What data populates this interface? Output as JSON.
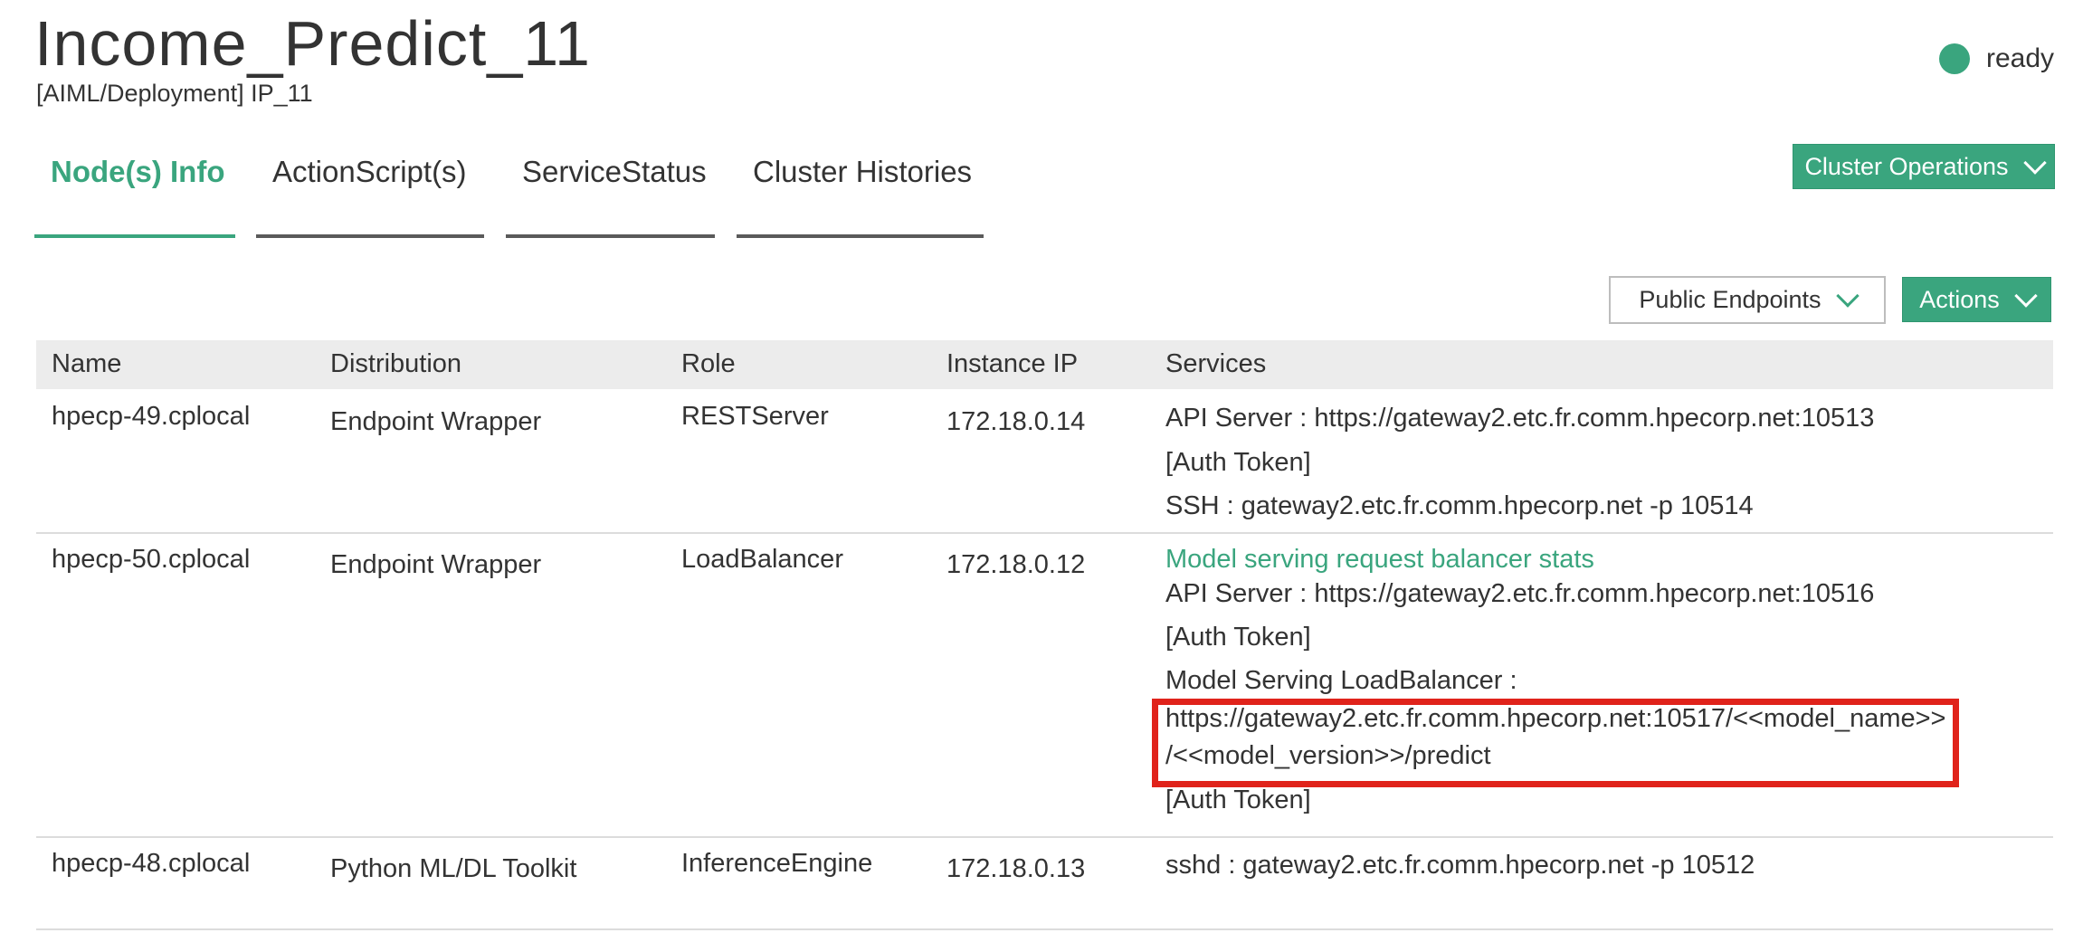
{
  "header": {
    "title": "Income_Predict_11",
    "subtitle": "[AIML/Deployment] IP_11",
    "status": "ready",
    "status_color": "#3aa57e"
  },
  "tabs": [
    {
      "label": "Node(s) Info",
      "active": true
    },
    {
      "label": "ActionScript(s)",
      "active": false
    },
    {
      "label": "ServiceStatus",
      "active": false
    },
    {
      "label": "Cluster Histories",
      "active": false
    }
  ],
  "toolbar": {
    "cluster_operations": "Cluster Operations",
    "public_endpoints": "Public Endpoints",
    "actions": "Actions"
  },
  "table": {
    "columns": [
      "Name",
      "Distribution",
      "Role",
      "Instance IP",
      "Services"
    ],
    "rows": [
      {
        "name": "hpecp-49.cplocal",
        "distribution": "Endpoint Wrapper",
        "role": "RESTServer",
        "ip": "172.18.0.14",
        "services": [
          "API Server : https://gateway2.etc.fr.comm.hpecorp.net:10513",
          "[Auth Token]",
          "SSH : gateway2.etc.fr.comm.hpecorp.net -p 10514"
        ]
      },
      {
        "name": "hpecp-50.cplocal",
        "distribution": "Endpoint Wrapper",
        "role": "LoadBalancer",
        "ip": "172.18.0.12",
        "stats_link": "Model serving request balancer stats",
        "services": [
          "API Server : https://gateway2.etc.fr.comm.hpecorp.net:10516",
          "[Auth Token]",
          "Model Serving LoadBalancer :"
        ],
        "lb_url_line1": "https://gateway2.etc.fr.comm.hpecorp.net:10517/<<model_name>>",
        "lb_url_line2": "/<<model_version>>/predict",
        "lb_auth": "[Auth Token]"
      },
      {
        "name": "hpecp-48.cplocal",
        "distribution": "Python ML/DL Toolkit",
        "role": "InferenceEngine",
        "ip": "172.18.0.13",
        "services": [
          "sshd : gateway2.etc.fr.comm.hpecorp.net -p 10512"
        ]
      }
    ]
  },
  "colors": {
    "accent": "#3aa57e",
    "highlight": "#e0231b"
  }
}
